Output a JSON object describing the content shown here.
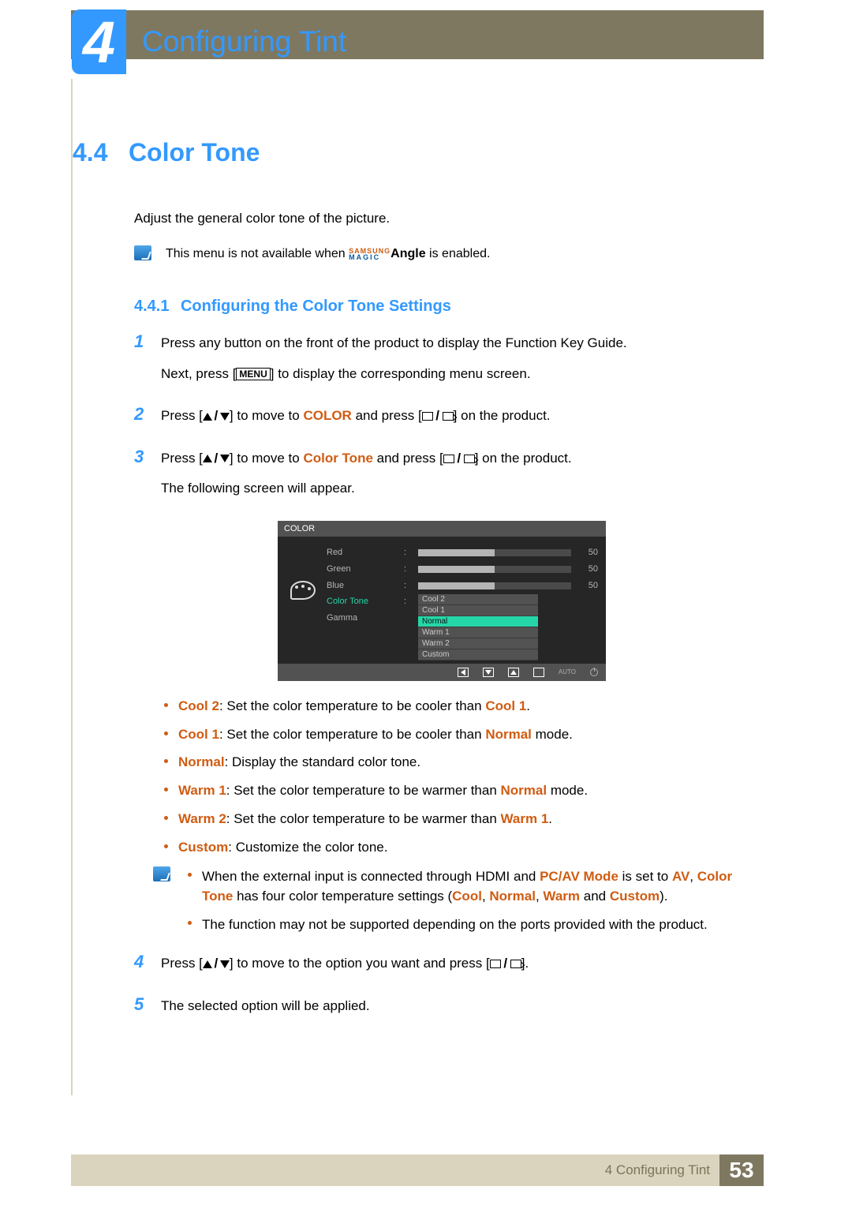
{
  "chapter": {
    "number": "4",
    "title": "Configuring Tint"
  },
  "section": {
    "number": "4.4",
    "title": "Color Tone"
  },
  "intro": "Adjust the general color tone of the picture.",
  "note1": {
    "prefix": "This menu is not available when ",
    "magic_top": "SAMSUNG",
    "magic_bot": "MAGIC",
    "angle": "Angle",
    "suffix": " is enabled."
  },
  "subsection": {
    "number": "4.4.1",
    "title": "Configuring the Color Tone Settings"
  },
  "steps": {
    "s1a": "Press any button on the front of the product to display the Function Key Guide.",
    "s1b_pre": "Next, press [",
    "s1b_menu": "MENU",
    "s1b_post": "] to display the corresponding menu screen.",
    "s2_pre": "Press [",
    "s2_mid": "] to move to ",
    "s2_color": "COLOR",
    "s2_and": " and press [",
    "s2_end": "] on the product.",
    "s3_pre": "Press [",
    "s3_mid": "] to move to ",
    "s3_ct": "Color Tone",
    "s3_and": " and press [",
    "s3_end": "] on the product.",
    "s3b": "The following screen will appear.",
    "s4_pre": "Press [",
    "s4_mid": "] to move to the option you want and press [",
    "s4_end": "].",
    "s5": "The selected option will be applied."
  },
  "osd": {
    "title": "COLOR",
    "rows": [
      {
        "label": "Red",
        "value": "50"
      },
      {
        "label": "Green",
        "value": "50"
      },
      {
        "label": "Blue",
        "value": "50"
      }
    ],
    "highlight_label": "Color Tone",
    "gamma_label": "Gamma",
    "options": [
      "Cool 2",
      "Cool 1",
      "Normal",
      "Warm 1",
      "Warm 2",
      "Custom"
    ],
    "selected_index": 2,
    "auto": "AUTO"
  },
  "bullets": {
    "b1_k": "Cool 2",
    "b1_t": ": Set the color temperature to be cooler than ",
    "b1_r": "Cool 1",
    "b1_e": ".",
    "b2_k": "Cool 1",
    "b2_t": ": Set the color temperature to be cooler than ",
    "b2_r": "Normal",
    "b2_e": " mode.",
    "b3_k": "Normal",
    "b3_t": ": Display the standard color tone.",
    "b4_k": "Warm 1",
    "b4_t": ": Set the color temperature to be warmer than ",
    "b4_r": "Normal",
    "b4_e": " mode.",
    "b5_k": "Warm 2",
    "b5_t": ": Set the color temperature to be warmer than ",
    "b5_r": "Warm 1",
    "b5_e": ".",
    "b6_k": "Custom",
    "b6_t": ": Customize the color tone."
  },
  "note2": {
    "l1_a": "When the external input is connected through HDMI and ",
    "l1_b": "PC/AV Mode",
    "l1_c": " is set to ",
    "l1_d": "AV",
    "l1_e": ", ",
    "l1_f": "Color Tone",
    "l1_g": " has four color temperature settings (",
    "l1_h": "Cool",
    "l1_i": ", ",
    "l1_j": "Normal",
    "l1_k": ", ",
    "l1_l": "Warm",
    "l1_m": " and ",
    "l1_n": "Custom",
    "l1_o": ").",
    "l2": "The function may not be supported depending on the ports provided with the product."
  },
  "footer": {
    "text": "4 Configuring Tint",
    "page": "53"
  }
}
